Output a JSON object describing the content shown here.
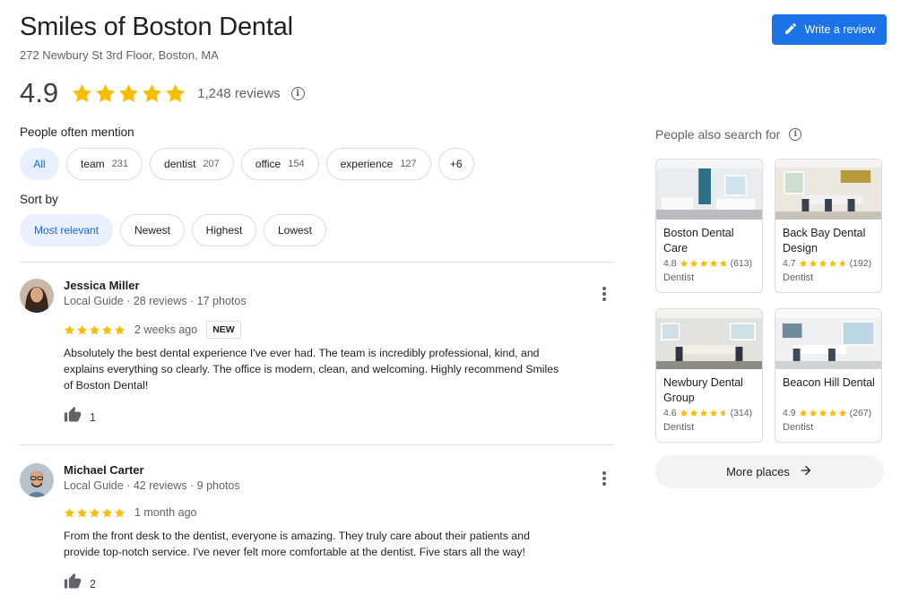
{
  "business": {
    "name": "Smiles of Boston Dental",
    "address": "272 Newbury St 3rd Floor, Boston, MA",
    "rating": "4.9",
    "stars": 5,
    "reviews_label": "1,248 reviews"
  },
  "actions": {
    "write_review_label": "Write a review"
  },
  "mentions": {
    "label": "People often mention",
    "chips": [
      {
        "label": "All",
        "count": ""
      },
      {
        "label": "team",
        "count": "231"
      },
      {
        "label": "dentist",
        "count": "207"
      },
      {
        "label": "office",
        "count": "154"
      },
      {
        "label": "experience",
        "count": "127"
      },
      {
        "label": "+6",
        "count": ""
      }
    ]
  },
  "sort": {
    "label": "Sort by",
    "options": [
      "Most relevant",
      "Newest",
      "Highest",
      "Lowest"
    ]
  },
  "reviews": [
    {
      "name": "Jessica Miller",
      "meta": "Local Guide · 28 reviews · 17 photos",
      "stars": 5,
      "date": "2 weeks ago",
      "badge": "NEW",
      "text": "Absolutely the best dental experience I've ever had. The team is incredibly professional, kind, and explains everything so clearly. The office is modern, clean, and welcoming. Highly recommend Smiles of Boston Dental!",
      "likes": "1"
    },
    {
      "name": "Michael Carter",
      "meta": "Local Guide · 42 reviews · 9 photos",
      "stars": 5,
      "date": "1 month ago",
      "badge": "",
      "text": "From the front desk to the dentist, everyone is amazing. They truly care about their patients and provide top-notch service. I've never felt more comfortable at the dentist. Five stars all the way!",
      "likes": "2"
    }
  ],
  "also_search": {
    "title": "People also search for",
    "places": [
      {
        "name": "Boston Dental Care",
        "rating": "4.8",
        "stars": 4.8,
        "count": "(613)",
        "category": "Dentist"
      },
      {
        "name": "Back Bay Dental Design",
        "rating": "4.7",
        "stars": 4.7,
        "count": "(192)",
        "category": "Dentist"
      },
      {
        "name": "Newbury Dental Group",
        "rating": "4.6",
        "stars": 4.6,
        "count": "(314)",
        "category": "Dentist"
      },
      {
        "name": "Beacon Hill Dental",
        "rating": "4.9",
        "stars": 4.9,
        "count": "(267)",
        "category": "Dentist"
      }
    ],
    "more_label": "More places"
  },
  "colors": {
    "accent": "#1a73e8",
    "star": "#fbbc04",
    "chip_active_bg": "#e8f0fe",
    "chip_active_text": "#1967d2"
  },
  "icons": {
    "write": "pencil-icon",
    "info": "info-icon",
    "more": "more-vert-icon",
    "like": "thumb-up-icon",
    "arrow": "arrow-right-icon"
  }
}
